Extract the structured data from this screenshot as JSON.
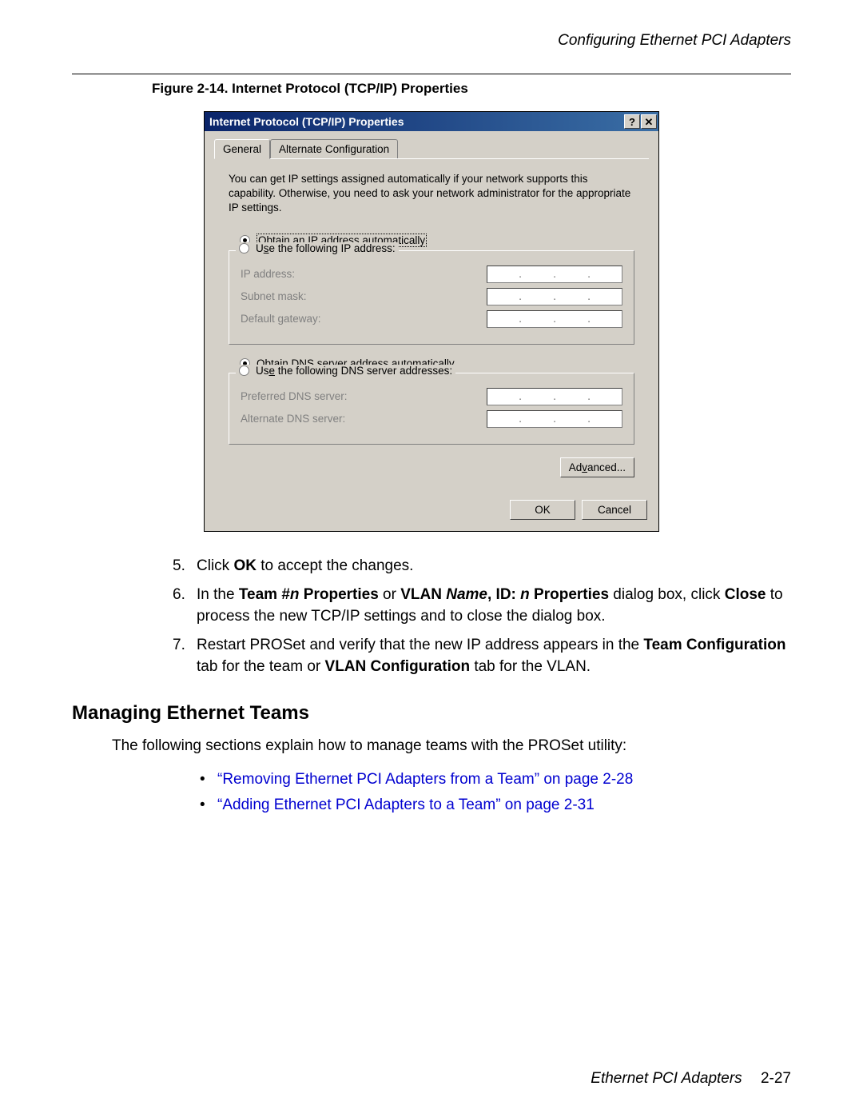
{
  "header": {
    "section_title": "Configuring Ethernet PCI Adapters"
  },
  "figure": {
    "caption": "Figure 2-14. Internet Protocol (TCP/IP) Properties"
  },
  "dialog": {
    "title": "Internet Protocol (TCP/IP) Properties",
    "help_btn": "?",
    "close_btn": "✕",
    "tabs": {
      "general": "General",
      "alt": "Alternate Configuration"
    },
    "intro": "You can get IP settings assigned automatically if your network supports this capability. Otherwise, you need to ask your network administrator for the appropriate IP settings.",
    "ip": {
      "auto": "Obtain an IP address automatically",
      "manual": "Use the following IP address:",
      "ip_label": "IP address:",
      "subnet_label": "Subnet mask:",
      "gateway_label": "Default gateway:"
    },
    "dns": {
      "auto": "Obtain DNS server address automatically",
      "manual": "Use the following DNS server addresses:",
      "preferred_label": "Preferred DNS server:",
      "alternate_label": "Alternate DNS server:"
    },
    "buttons": {
      "advanced": "Advanced...",
      "ok": "OK",
      "cancel": "Cancel"
    }
  },
  "steps": {
    "s5_num": "5.",
    "s5_a": "Click ",
    "s5_b": "OK",
    "s5_c": " to accept the changes.",
    "s6_num": "6.",
    "s6_a": "In the ",
    "s6_b": "Team #",
    "s6_c": "n",
    "s6_d": " Properties",
    "s6_e": " or ",
    "s6_f": "VLAN ",
    "s6_g": "Name",
    "s6_h": ", ID: ",
    "s6_i": "n",
    "s6_j": " Properties",
    "s6_k": " dialog box, click ",
    "s6_l": "Close",
    "s6_m": " to process the new TCP/IP settings and to close the dialog box.",
    "s7_num": "7.",
    "s7_a": "Restart PROSet and verify that the new IP address appears in the ",
    "s7_b": "Team Configuration",
    "s7_c": " tab for the team or ",
    "s7_d": "VLAN Configuration",
    "s7_e": " tab for the VLAN."
  },
  "section2": {
    "heading": "Managing Ethernet Teams",
    "para": "The following sections explain how to manage teams with the PROSet utility:",
    "bullets": {
      "b1": "“Removing Ethernet PCI Adapters from a Team” on page 2-28",
      "b2": "“Adding Ethernet PCI Adapters to a Team” on page 2-31"
    }
  },
  "footer": {
    "label": "Ethernet PCI Adapters",
    "page": "2-27"
  }
}
